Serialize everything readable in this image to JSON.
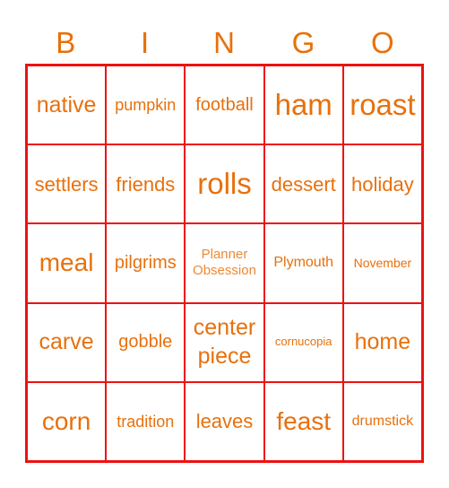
{
  "header": {
    "letters": [
      "B",
      "I",
      "N",
      "G",
      "O"
    ]
  },
  "colors": {
    "text": "#E8700C",
    "border": "#EE1111",
    "free_text": "#EC8A33"
  },
  "grid": {
    "rows": [
      [
        "native",
        "pumpkin",
        "football",
        "ham",
        "roast"
      ],
      [
        "settlers",
        "friends",
        "rolls",
        "dessert",
        "holiday"
      ],
      [
        "meal",
        "pilgrims",
        "Planner Obsession",
        "Plymouth",
        "November"
      ],
      [
        "carve",
        "gobble",
        "center piece",
        "cornucopia",
        "home"
      ],
      [
        "corn",
        "tradition",
        "leaves",
        "feast",
        "drumstick"
      ]
    ],
    "free_space": {
      "line1": "Planner",
      "line2": "Obsession"
    },
    "centerpiece": {
      "line1": "center",
      "line2": "piece"
    }
  }
}
